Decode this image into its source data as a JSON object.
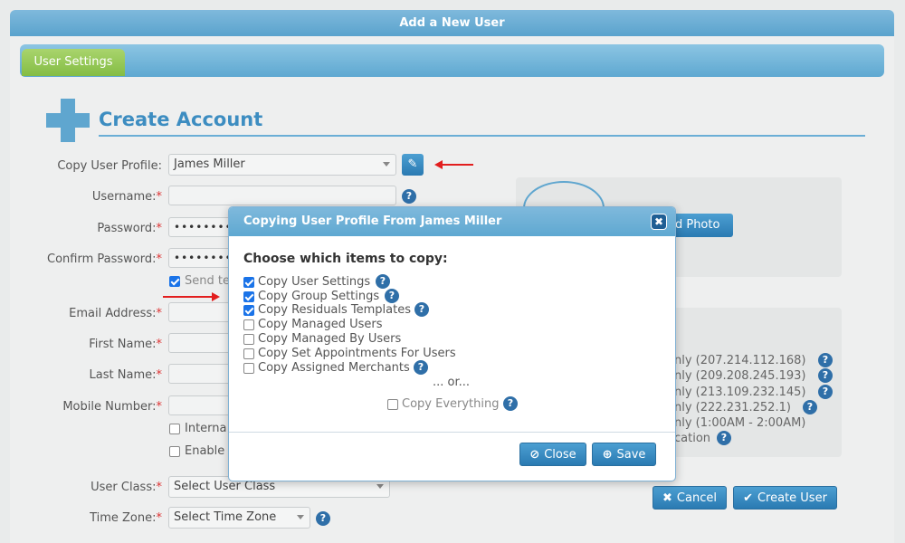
{
  "window": {
    "title": "Add a New User"
  },
  "tabs": [
    {
      "label": "User Settings"
    }
  ],
  "heading": "Create Account",
  "form": {
    "copy_profile_label": "Copy User Profile:",
    "copy_profile_value": "James Miller",
    "username_label": "Username:",
    "password_label": "Password:",
    "password_mask": "••••••••",
    "confirm_label": "Confirm Password:",
    "send_label": "Send te",
    "email_label": "Email Address:",
    "first_label": "First Name:",
    "last_label": "Last Name:",
    "mobile_label": "Mobile Number:",
    "internal_label": "Interna",
    "enable_label": "Enable",
    "user_class_label": "User Class:",
    "user_class_value": "Select User Class",
    "time_zone_label": "Time Zone:",
    "time_zone_value": "Select Time Zone",
    "required_mark": "*"
  },
  "photo": {
    "upload_label": "ad Photo"
  },
  "ip_restrictions": [
    "nly (207.214.112.168)",
    "nly (209.208.245.193)",
    "nly (213.109.232.145)",
    "nly (222.231.252.1)",
    "nly (1:00AM - 2:00AM)",
    "cation"
  ],
  "buttons": {
    "cancel": "Cancel",
    "create": "Create User"
  },
  "modal": {
    "title": "Copying User Profile From James Miller",
    "prompt": "Choose which items to copy:",
    "options": [
      {
        "label": "Copy User Settings",
        "checked": true
      },
      {
        "label": "Copy Group Settings",
        "checked": true
      },
      {
        "label": "Copy Residuals Templates",
        "checked": true
      },
      {
        "label": "Copy Managed Users",
        "checked": false
      },
      {
        "label": "Copy Managed By Users",
        "checked": false
      },
      {
        "label": "Copy Set Appointments For Users",
        "checked": false
      },
      {
        "label": "Copy Assigned Merchants",
        "checked": false
      }
    ],
    "or_text": "... or...",
    "everything_label": "Copy Everything",
    "close_label": "Close",
    "save_label": "Save"
  },
  "help_glyph": "?"
}
